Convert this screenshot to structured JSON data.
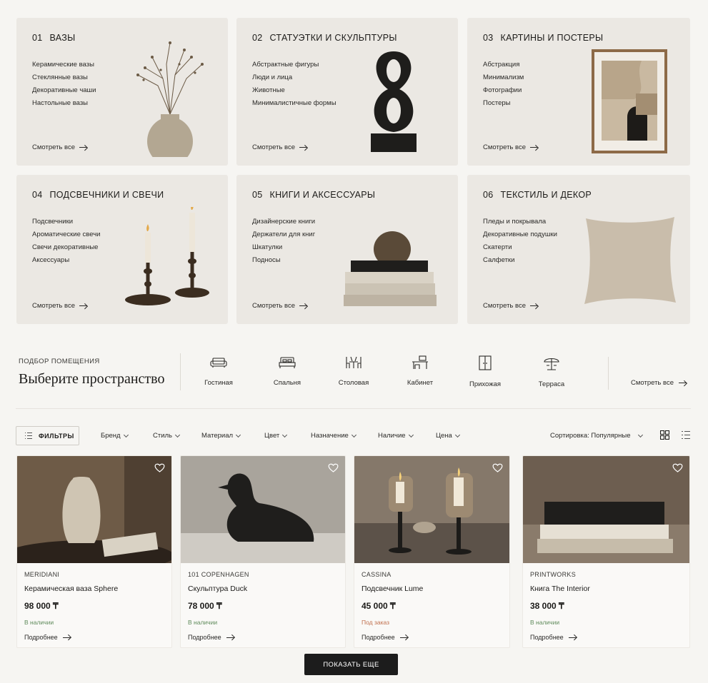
{
  "categories": [
    {
      "num": "01",
      "title": "ВАЗЫ",
      "links": [
        "Керамические вазы",
        "Стеклянные вазы",
        "Декоративные чаши",
        "Настольные вазы"
      ],
      "more": "Смотреть все"
    },
    {
      "num": "02",
      "title": "СТАТУЭТКИ И СКУЛЬПТУРЫ",
      "links": [
        "Абстрактные фигуры",
        "Люди и лица",
        "Животные",
        "Минималистичные формы"
      ],
      "more": "Смотреть все"
    },
    {
      "num": "03",
      "title": "КАРТИНЫ И ПОСТЕРЫ",
      "links": [
        "Абстракция",
        "Минимализм",
        "Фотографии",
        "Постеры"
      ],
      "more": "Смотреть все"
    },
    {
      "num": "04",
      "title": "ПОДСВЕЧНИКИ И СВЕЧИ",
      "links": [
        "Подсвечники",
        "Ароматические свечи",
        "Свечи декоративные",
        "Аксессуары"
      ],
      "more": "Смотреть все"
    },
    {
      "num": "05",
      "title": "КНИГИ И АКСЕССУАРЫ",
      "links": [
        "Дизайнерские книги",
        "Держатели для книг",
        "Шкатулки",
        "Подносы"
      ],
      "more": "Смотреть все"
    },
    {
      "num": "06",
      "title": "ТЕКСТИЛЬ И ДЕКОР",
      "links": [
        "Пледы и покрывала",
        "Декоративные подушки",
        "Скатерти",
        "Салфетки"
      ],
      "more": "Смотреть все"
    }
  ],
  "rooms": {
    "eyebrow": "ПОДБОР ПОМЕЩЕНИЯ",
    "heading": "Выберите пространство",
    "items": [
      {
        "label": "Гостиная",
        "icon": "sofa-icon"
      },
      {
        "label": "Спальня",
        "icon": "bed-icon"
      },
      {
        "label": "Столовая",
        "icon": "dining-icon"
      },
      {
        "label": "Кабинет",
        "icon": "desk-icon"
      },
      {
        "label": "Прихожая",
        "icon": "wardrobe-icon"
      },
      {
        "label": "Терраса",
        "icon": "umbrella-icon"
      }
    ],
    "more": "Смотреть все"
  },
  "filters": {
    "button": "ФИЛЬТРЫ",
    "dropdowns": [
      "Бренд",
      "Стиль",
      "Материал",
      "Цвет",
      "Назначение",
      "Наличие",
      "Цена"
    ],
    "sort": "Сортировка: Популярные"
  },
  "products": [
    {
      "brand": "MERIDIANI",
      "name": "Керамическая ваза Sphere",
      "price": "98 000 ₸",
      "availability": "В наличии",
      "availability_color": "#5e8a5a",
      "more": "Подробнее"
    },
    {
      "brand": "101 COPENHAGEN",
      "name": "Скульптура Duck",
      "price": "78 000 ₸",
      "availability": "В наличии",
      "availability_color": "#5e8a5a",
      "more": "Подробнее"
    },
    {
      "brand": "CASSINA",
      "name": "Подсвечник Lume",
      "price": "45 000 ₸",
      "availability": "Под заказ",
      "availability_color": "#c0704e",
      "more": "Подробнее"
    },
    {
      "brand": "PRINTWORKS",
      "name": "Книга The Interior",
      "price": "38 000 ₸",
      "availability": "В наличии",
      "availability_color": "#5e8a5a",
      "more": "Подробнее"
    }
  ],
  "load_more": "ПОКАЗАТЬ ЕЩЕ"
}
